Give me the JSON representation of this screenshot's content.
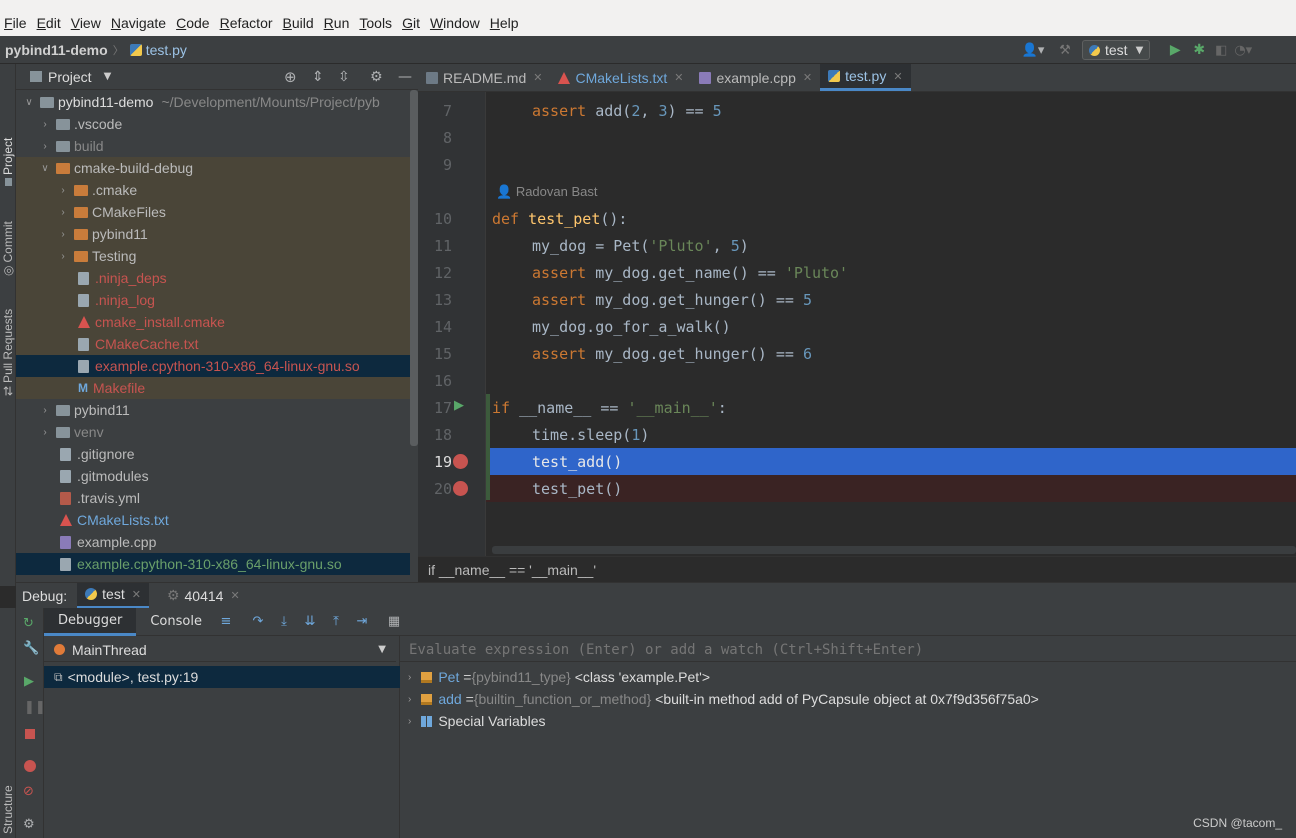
{
  "menubar": {
    "items": [
      "File",
      "Edit",
      "View",
      "Navigate",
      "Code",
      "Refactor",
      "Build",
      "Run",
      "Tools",
      "Git",
      "Window",
      "Help"
    ]
  },
  "navbar": {
    "project": "pybind11-demo",
    "file": "test.py",
    "run_config": "test"
  },
  "leftstrip": {
    "project": "Project",
    "commit": "Commit",
    "pull_requests": "Pull Requests",
    "structure": "Structure"
  },
  "project_panel": {
    "title": "Project",
    "tree": [
      {
        "name": "pybind11-demo",
        "extra": "~/Development/Mounts/Project/pyb"
      },
      {
        "name": ".vscode"
      },
      {
        "name": "build"
      },
      {
        "name": "cmake-build-debug"
      },
      {
        "name": ".cmake"
      },
      {
        "name": "CMakeFiles"
      },
      {
        "name": "pybind11"
      },
      {
        "name": "Testing"
      },
      {
        "name": ".ninja_deps"
      },
      {
        "name": ".ninja_log"
      },
      {
        "name": "cmake_install.cmake"
      },
      {
        "name": "CMakeCache.txt"
      },
      {
        "name": "example.cpython-310-x86_64-linux-gnu.so"
      },
      {
        "name": "Makefile"
      },
      {
        "name": "pybind11"
      },
      {
        "name": "venv"
      },
      {
        "name": ".gitignore"
      },
      {
        "name": ".gitmodules"
      },
      {
        "name": ".travis.yml"
      },
      {
        "name": "CMakeLists.txt"
      },
      {
        "name": "example.cpp"
      },
      {
        "name": "example.cpython-310-x86_64-linux-gnu.so"
      }
    ]
  },
  "editor": {
    "tabs": [
      "README.md",
      "CMakeLists.txt",
      "example.cpp",
      "test.py"
    ],
    "author": "Radovan Bast",
    "lines": [
      {
        "n": "7",
        "text": "    assert add(2, 3) == 5"
      },
      {
        "n": "8",
        "text": ""
      },
      {
        "n": "9",
        "text": ""
      },
      {
        "n": "10",
        "text": "def test_pet():"
      },
      {
        "n": "11",
        "text": "    my_dog = Pet('Pluto', 5)"
      },
      {
        "n": "12",
        "text": "    assert my_dog.get_name() == 'Pluto'"
      },
      {
        "n": "13",
        "text": "    assert my_dog.get_hunger() == 5"
      },
      {
        "n": "14",
        "text": "    my_dog.go_for_a_walk()"
      },
      {
        "n": "15",
        "text": "    assert my_dog.get_hunger() == 6"
      },
      {
        "n": "16",
        "text": ""
      },
      {
        "n": "17",
        "text": "if __name__ == '__main__':"
      },
      {
        "n": "18",
        "text": "    time.sleep(1)"
      },
      {
        "n": "19",
        "text": "    test_add()"
      },
      {
        "n": "20",
        "text": "    test_pet()"
      }
    ],
    "breadcrumb": "if __name__ == '__main__'"
  },
  "debug": {
    "label": "Debug:",
    "sessions": [
      "test",
      "40414"
    ],
    "tabs": [
      "Debugger",
      "Console"
    ],
    "thread": "MainThread",
    "frame": "<module>, test.py:19",
    "eval_placeholder": "Evaluate expression (Enter) or add a watch (Ctrl+Shift+Enter)",
    "variables": [
      {
        "name": "Pet",
        "type": "{pybind11_type}",
        "value": "<class 'example.Pet'>"
      },
      {
        "name": "add",
        "type": "{builtin_function_or_method}",
        "value": "<built-in method add of PyCapsule object at 0x7f9d356f75a0>"
      },
      {
        "name": "Special Variables",
        "type": "",
        "value": ""
      }
    ]
  },
  "watermark": "CSDN @tacom_",
  "colors": {
    "accent": "#4a88c7",
    "selection": "#2f65ca",
    "breakpoint": "#c75450",
    "breakpoint_line": "#3a2323",
    "dirty_bg": "#4a4538",
    "selected_bg": "#0d293e"
  }
}
